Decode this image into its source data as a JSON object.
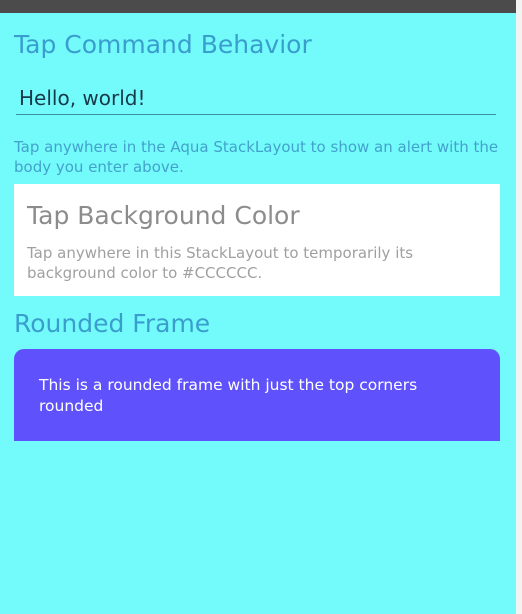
{
  "tap_command": {
    "title": "Tap Command Behavior",
    "entry_value": "Hello, world!",
    "description": "Tap anywhere in the Aqua StackLayout to show an alert with the body you enter above."
  },
  "tap_background": {
    "title": "Tap Background Color",
    "description": "Tap anywhere in this StackLayout to temporarily its background color to #CCCCCC."
  },
  "rounded_frame": {
    "title": "Rounded Frame",
    "text": "This is a rounded frame with just the top corners rounded"
  },
  "colors": {
    "page_background": "#73fbfc",
    "accent_text": "#3a9ecd",
    "frame_background": "#5f52fc",
    "card_background": "#ffffff"
  }
}
